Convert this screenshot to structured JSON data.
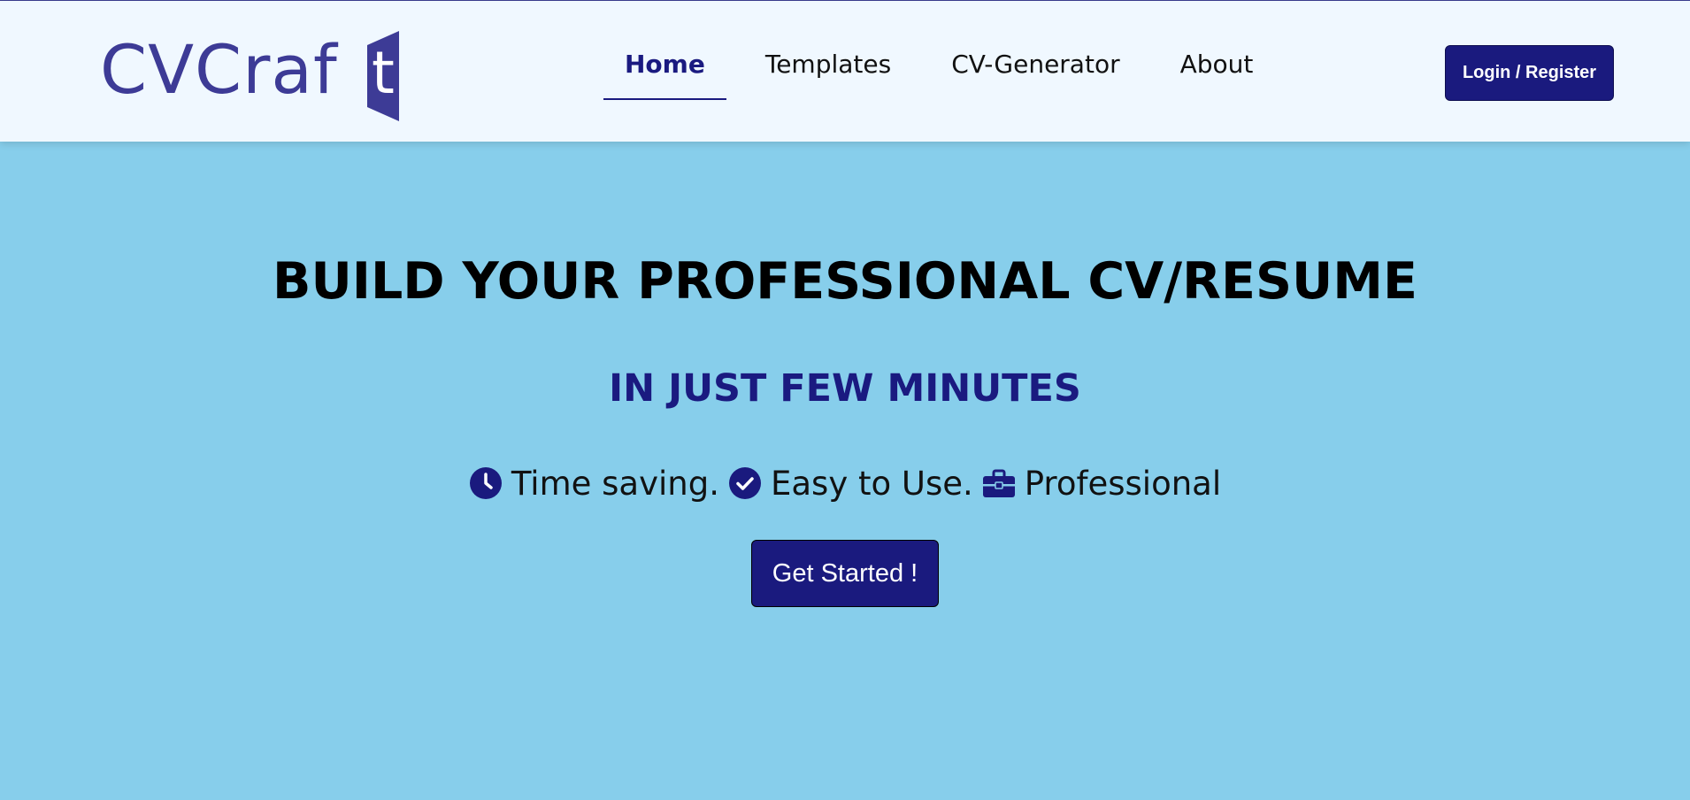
{
  "brand": {
    "logo_text": "CVCraf",
    "logo_last_letter": "t",
    "logo_color": "#3d3b96"
  },
  "nav": {
    "items": [
      {
        "label": "Home",
        "active": true
      },
      {
        "label": "Templates",
        "active": false
      },
      {
        "label": "CV-Generator",
        "active": false
      },
      {
        "label": "About",
        "active": false
      }
    ]
  },
  "header": {
    "login_label": "Login / Register"
  },
  "hero": {
    "title": "BUILD YOUR PROFESSIONAL CV/RESUME",
    "subtitle": "IN JUST FEW MINUTES",
    "features": [
      {
        "icon": "clock-icon",
        "label": "Time saving."
      },
      {
        "icon": "check-circle-icon",
        "label": "Easy to Use."
      },
      {
        "icon": "briefcase-icon",
        "label": "Professional"
      }
    ],
    "cta_label": "Get Started !"
  },
  "colors": {
    "background": "#87ceeb",
    "header_bg": "#f0f8ff",
    "primary": "#1a1a7e"
  }
}
